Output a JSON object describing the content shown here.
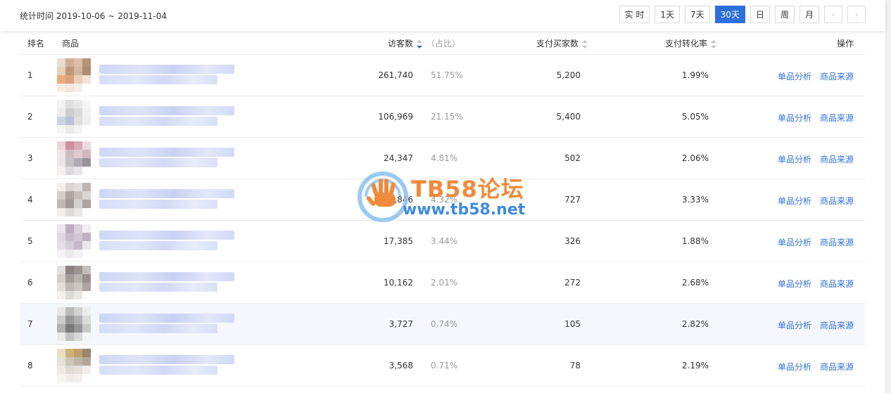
{
  "header": {
    "stat_time": "统计时间 2019-10-06 ~ 2019-11-04",
    "range_buttons": [
      {
        "label": "实 时",
        "active": false
      },
      {
        "label": "1天",
        "active": false
      },
      {
        "label": "7天",
        "active": false
      },
      {
        "label": "30天",
        "active": true
      },
      {
        "label": "日",
        "active": false
      },
      {
        "label": "周",
        "active": false
      },
      {
        "label": "月",
        "active": false
      }
    ],
    "prev_icon": "chevron-left-icon",
    "next_icon": "chevron-right-icon",
    "prev_glyph": "‹",
    "next_glyph": "›"
  },
  "table": {
    "columns": {
      "rank": "排名",
      "product": "商品",
      "visitors": "访客数",
      "share": "（占比）",
      "buyers": "支付买家数",
      "conversion": "支付转化率",
      "ops": "操作"
    },
    "rows": [
      {
        "rank": "1",
        "visitors": "261,740",
        "share": "51.75%",
        "buyers": "5,200",
        "conversion": "1.99%",
        "thumb": [
          "#e8d8c8",
          "#c9a58a",
          "#d8b79a",
          "#b08866",
          "#e3cbb4",
          "#b98d6e",
          "#cfae94",
          "#a8805f",
          "#e9a26a",
          "#d49a70",
          "#e8c9ab",
          "#f0e2d3",
          "#f3ece4",
          "#efe4da",
          "#f5eee8",
          "#ffffff"
        ]
      },
      {
        "rank": "2",
        "visitors": "106,969",
        "share": "21.15%",
        "buyers": "5,400",
        "conversion": "5.05%",
        "thumb": [
          "#f2f2f2",
          "#dcdcdc",
          "#e6e6e6",
          "#f6f6f6",
          "#eaeaea",
          "#c9c9c9",
          "#d6d6d6",
          "#f0f0f0",
          "#c8cde2",
          "#b5bbd3",
          "#dcdcdc",
          "#eeeeee",
          "#f5f5f5",
          "#e9e9e9",
          "#f2f2f2",
          "#ffffff"
        ]
      },
      {
        "rank": "3",
        "visitors": "24,347",
        "share": "4.81%",
        "buyers": "502",
        "conversion": "2.06%",
        "thumb": [
          "#e7d2d8",
          "#c78595",
          "#d5a3b0",
          "#ead8de",
          "#efe2e6",
          "#c9b5bb",
          "#dcc8ce",
          "#cbb0b8",
          "#e8e2e4",
          "#c2bcc2",
          "#a9a3aa",
          "#8e888f",
          "#f3efef",
          "#d9d6d9",
          "#e6e3e6",
          "#ffffff"
        ]
      },
      {
        "rank": "4",
        "visitors": "21,846",
        "share": "4.32%",
        "buyers": "727",
        "conversion": "3.33%",
        "thumb": [
          "#f2f0ef",
          "#d7d1ce",
          "#e1dcda",
          "#b8aeaa",
          "#cfc7c3",
          "#a69b97",
          "#c1b8b4",
          "#d8d1ce",
          "#b9b1af",
          "#9a8f8c",
          "#d2cbc9",
          "#a59c99",
          "#f0eceb",
          "#dcd7d5",
          "#e8e4e3",
          "#ffffff"
        ]
      },
      {
        "rank": "5",
        "visitors": "17,385",
        "share": "3.44%",
        "buyers": "326",
        "conversion": "1.88%",
        "thumb": [
          "#eae4ec",
          "#b8a5bd",
          "#d7cbda",
          "#f1ecf2",
          "#dcd2df",
          "#c1b2c6",
          "#cfc1d3",
          "#b9a9bf",
          "#e3dbe6",
          "#d1c6d5",
          "#c0b1c4",
          "#eae4ec",
          "#f4f1f5",
          "#ebe6ed",
          "#f2eef3",
          "#ffffff"
        ]
      },
      {
        "rank": "6",
        "visitors": "10,162",
        "share": "2.01%",
        "buyers": "272",
        "conversion": "2.68%",
        "thumb": [
          "#dedcdb",
          "#7d7775",
          "#8f8986",
          "#bdb8b6",
          "#cfcac8",
          "#9a928f",
          "#b1aaa7",
          "#8d8582",
          "#e0dcda",
          "#b9b2af",
          "#c7c1be",
          "#a39b98",
          "#f2efee",
          "#dbd6d4",
          "#e8e4e2",
          "#ffffff"
        ]
      },
      {
        "rank": "7",
        "visitors": "3,727",
        "share": "0.74%",
        "buyers": "105",
        "conversion": "2.82%",
        "thumb": [
          "#e6e6e6",
          "#b3b3b3",
          "#cfcfcf",
          "#ededed",
          "#c7c7c7",
          "#8e8e8e",
          "#a9a9a9",
          "#d9d9d9",
          "#aaaaaa",
          "#6e6e6e",
          "#8c8c8c",
          "#c4c4c4",
          "#e9e9e9",
          "#bdbdbd",
          "#d4d4d4",
          "#f5f5f5"
        ]
      },
      {
        "rank": "8",
        "visitors": "3,568",
        "share": "0.71%",
        "buyers": "78",
        "conversion": "2.19%",
        "thumb": [
          "#eadcc0",
          "#c9a96d",
          "#b9965e",
          "#8f7a5b",
          "#e5ded2",
          "#c9c0b3",
          "#b8ad9f",
          "#a89c8d",
          "#ede9e3",
          "#dcd6cf",
          "#e1dbd4",
          "#f0ece7",
          "#f6f4f1",
          "#eeebe7",
          "#f3f0ec",
          "#ffffff"
        ]
      }
    ],
    "op_labels": [
      "单品分析",
      "商品来源"
    ],
    "hover_row_index": 6
  },
  "watermark": {
    "title": "TB58论坛",
    "url": "www.tb58.net",
    "logo_icon": "tb58-hand-logo-icon",
    "colors": {
      "orange": "#f08a3c",
      "blue": "#3d8be0"
    }
  },
  "colors": {
    "accent": "#2e6fe0",
    "muted_text": "#999999",
    "border": "#ececec"
  }
}
